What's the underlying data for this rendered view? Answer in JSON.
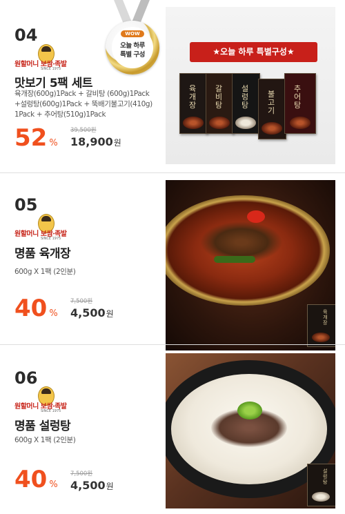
{
  "brand": {
    "name": "원할머니 보쌈·족발",
    "since": "SINCE 1975"
  },
  "items": [
    {
      "number": "04",
      "title": "맛보기 5팩 세트",
      "desc_lines": [
        "육개장(600g)1Pack + 갈비탕 (600g)1Pack",
        "+설렁탕(600g)1Pack + 뚝배기불고기(410g)",
        "1Pack + 추어탕(510g)1Pack"
      ],
      "discount": "52",
      "percent_sign": "%",
      "original_price": "39,500원",
      "price": "18,900",
      "price_unit": "원",
      "badge": {
        "tag": "WOW",
        "line1": "오늘 하루",
        "line2": "특별 구성"
      },
      "image_banner": "★오늘 하루 특별구성★",
      "boxes": [
        "육개장",
        "갈비탕",
        "설렁탕",
        "불고기",
        "추어탕"
      ]
    },
    {
      "number": "05",
      "title": "명품 육개장",
      "desc": "600g X 1팩 (2인분)",
      "discount": "40",
      "percent_sign": "%",
      "original_price": "7,500원",
      "price": "4,500",
      "price_unit": "원",
      "package_label": "육개장"
    },
    {
      "number": "06",
      "title": "명품 설렁탕",
      "desc": "600g X 1팩 (2인분)",
      "discount": "40",
      "percent_sign": "%",
      "original_price": "7,500원",
      "price": "4,500",
      "price_unit": "원",
      "package_label": "설렁탕"
    }
  ],
  "colors": {
    "discount": "#f0501e",
    "banner": "#c8201a",
    "medal_gold": "#d6b24a"
  }
}
